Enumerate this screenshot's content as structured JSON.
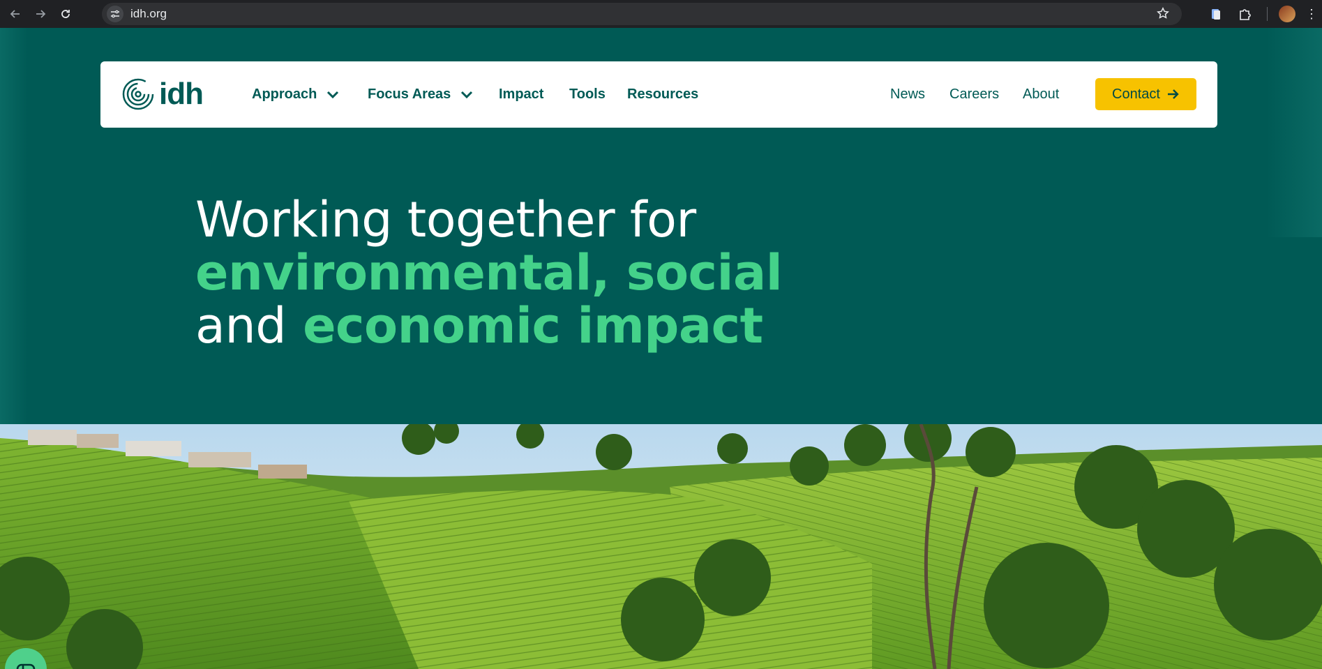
{
  "browser": {
    "url": "idh.org",
    "back_icon": "arrow-left-icon",
    "forward_icon": "arrow-right-icon",
    "reload_icon": "reload-icon",
    "star_icon": "star-icon"
  },
  "nav": {
    "logo_text": "idh",
    "menu": [
      {
        "label": "Approach",
        "has_dropdown": true
      },
      {
        "label": "Focus Areas",
        "has_dropdown": true
      },
      {
        "label": "Impact",
        "has_dropdown": false
      },
      {
        "label": "Tools",
        "has_dropdown": false
      },
      {
        "label": "Resources",
        "has_dropdown": false
      }
    ],
    "right_links": [
      "News",
      "Careers",
      "About"
    ],
    "contact_label": "Contact"
  },
  "hero": {
    "line1": "Working together for",
    "line2": "environmental, social",
    "line3_plain": "and",
    "line3_accent": "economic impact"
  },
  "colors": {
    "background": "#005a55",
    "accent_green": "#44d28a",
    "contact_yellow": "#f7c200",
    "nav_text": "#005a55"
  },
  "chat_widget": {
    "icon": "chat-loop-icon"
  }
}
